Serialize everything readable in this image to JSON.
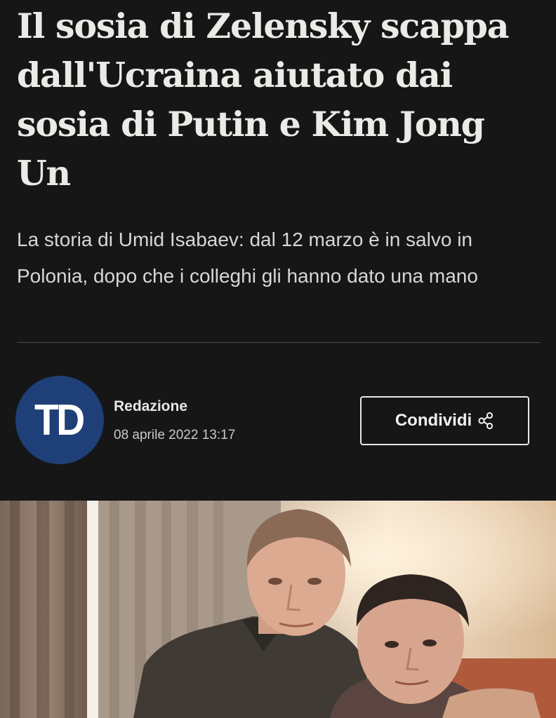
{
  "article": {
    "headline": "Il sosia di Zelensky scappa dall'Ucraina aiutato dai sosia di Putin e Kim Jong Un",
    "subtitle": "La storia di Umid Isabaev: dal 12 marzo è in salvo in Polonia, dopo che i colleghi gli hanno dato una mano"
  },
  "byline": {
    "logo_text": "TD",
    "author": "Redazione",
    "date": "08 aprile 2022 13:17",
    "logo_color": "#1f3f78"
  },
  "share": {
    "label": "Condividi",
    "icon": "share-icon"
  },
  "theme": {
    "background": "#161617",
    "text": "#eceae6"
  }
}
